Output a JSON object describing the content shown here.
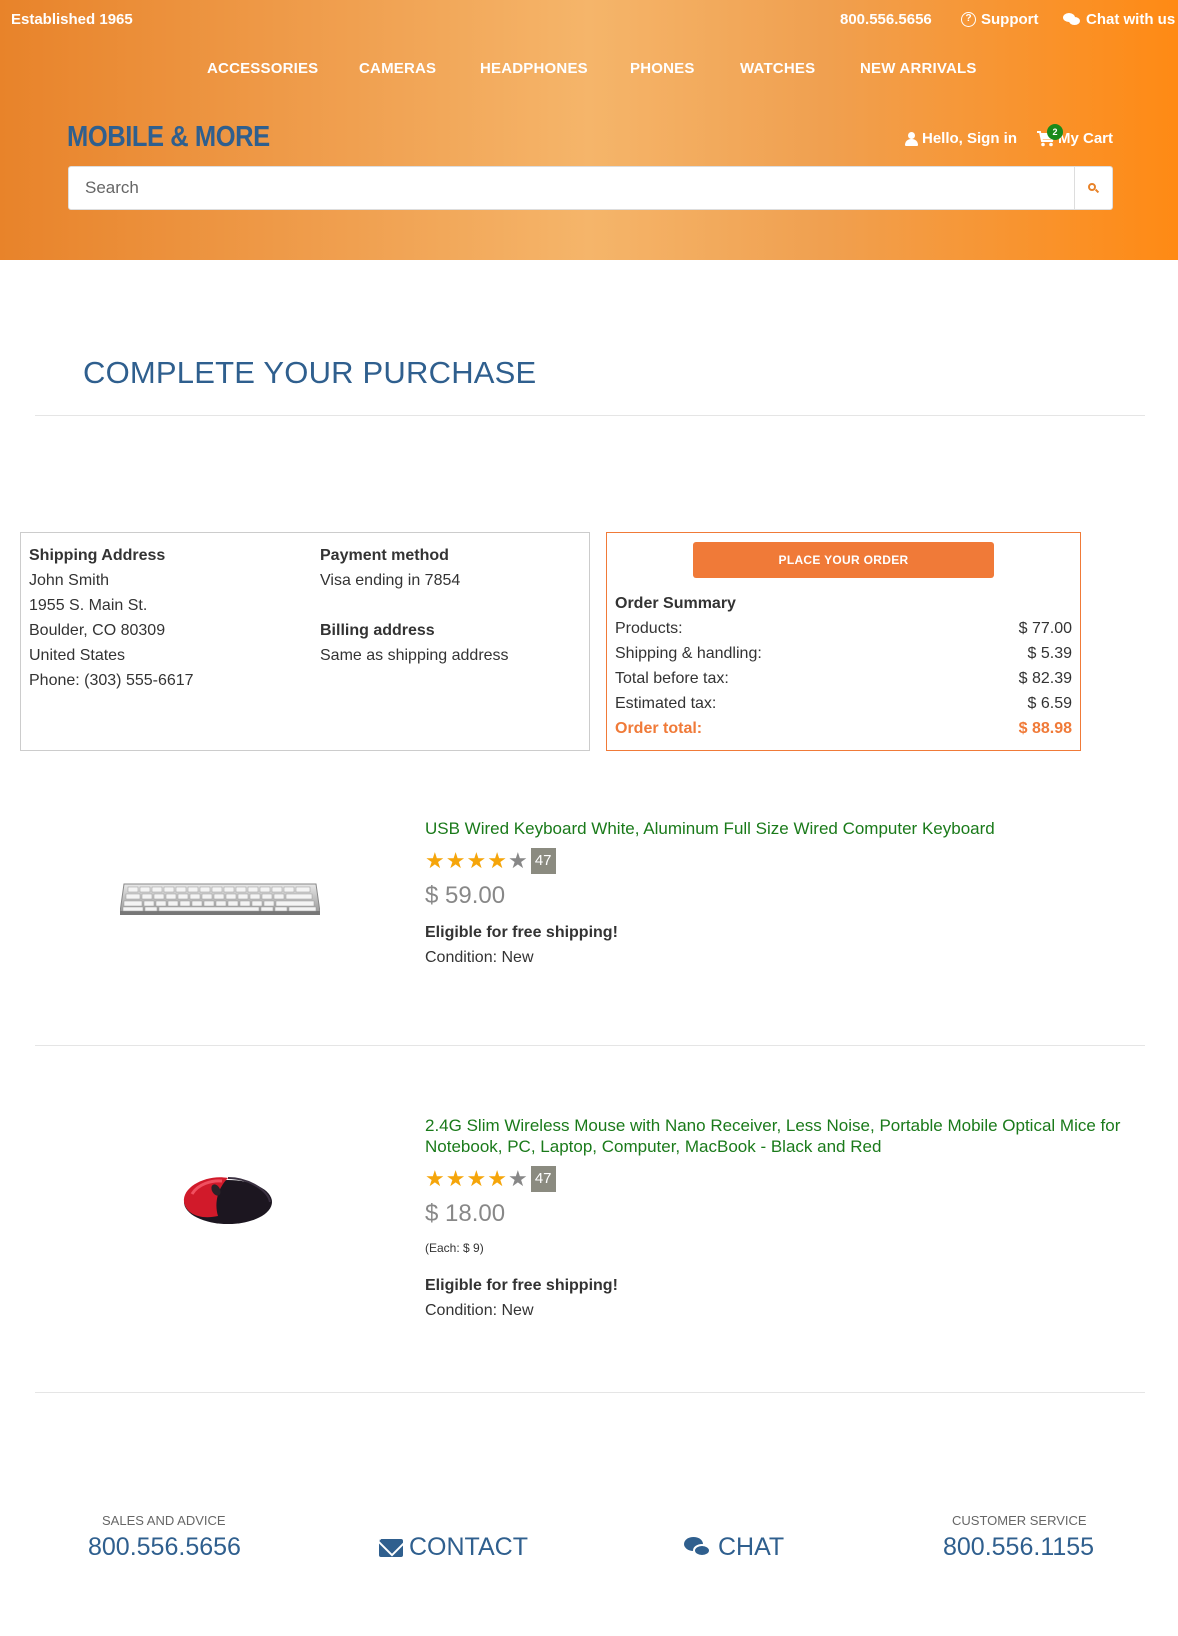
{
  "topbar": {
    "established": "Established 1965",
    "phone": "800.556.5656",
    "support": "Support",
    "chat": "Chat with us"
  },
  "nav": {
    "items": [
      "ACCESSORIES",
      "CAMERAS",
      "HEADPHONES",
      "PHONES",
      "WATCHES",
      "NEW ARRIVALS"
    ]
  },
  "brand": {
    "logo": "MOBILE & MORE",
    "signin": "Hello, Sign in",
    "cart_label": "My Cart",
    "cart_count": "2"
  },
  "search": {
    "placeholder": "Search"
  },
  "page": {
    "title": "COMPLETE YOUR PURCHASE"
  },
  "shipping": {
    "heading": "Shipping Address",
    "name": "John Smith",
    "street": "1955 S. Main St.",
    "city": "Boulder, CO 80309",
    "country": "United States",
    "phone": "Phone: (303) 555-6617"
  },
  "payment": {
    "heading": "Payment method",
    "method": "Visa ending in 7854",
    "billing_heading": "Billing address",
    "billing": "Same as shipping address"
  },
  "summary": {
    "button": "PLACE YOUR ORDER",
    "heading": "Order Summary",
    "rows": [
      {
        "label": "Products:",
        "value": "$ 77.00"
      },
      {
        "label": "Shipping & handling:",
        "value": "$ 5.39"
      },
      {
        "label": "Total before tax:",
        "value": "$ 82.39"
      },
      {
        "label": "Estimated tax:",
        "value": "$ 6.59"
      },
      {
        "label": "Order total:",
        "value": "$ 88.98"
      }
    ]
  },
  "products": [
    {
      "title": "USB Wired Keyboard White, Aluminum Full Size Wired Computer Keyboard",
      "rating": 4,
      "rating_count": "47",
      "price": "$ 59.00",
      "shipping": "Eligible for free shipping!",
      "condition": "Condition: New",
      "image": "keyboard-image"
    },
    {
      "title": "2.4G Slim Wireless Mouse with Nano Receiver, Less Noise, Portable Mobile Optical Mice for Notebook, PC, Laptop, Computer, MacBook - Black and Red",
      "rating": 4,
      "rating_count": "47",
      "price": "$ 18.00",
      "each": "(Each: $ 9)",
      "shipping": "Eligible for free shipping!",
      "condition": "Condition: New",
      "image": "mouse-image"
    }
  ],
  "footer": {
    "sales_label": "SALES AND ADVICE",
    "sales_phone": "800.556.5656",
    "contact": "CONTACT",
    "chat": "CHAT",
    "service_label": "CUSTOMER SERVICE",
    "service_phone": "800.556.1155"
  },
  "colors": {
    "brand_blue": "#2f5f8e",
    "accent_orange": "#f07a38",
    "product_green": "#1a7a1a",
    "star": "#f5a50a"
  }
}
